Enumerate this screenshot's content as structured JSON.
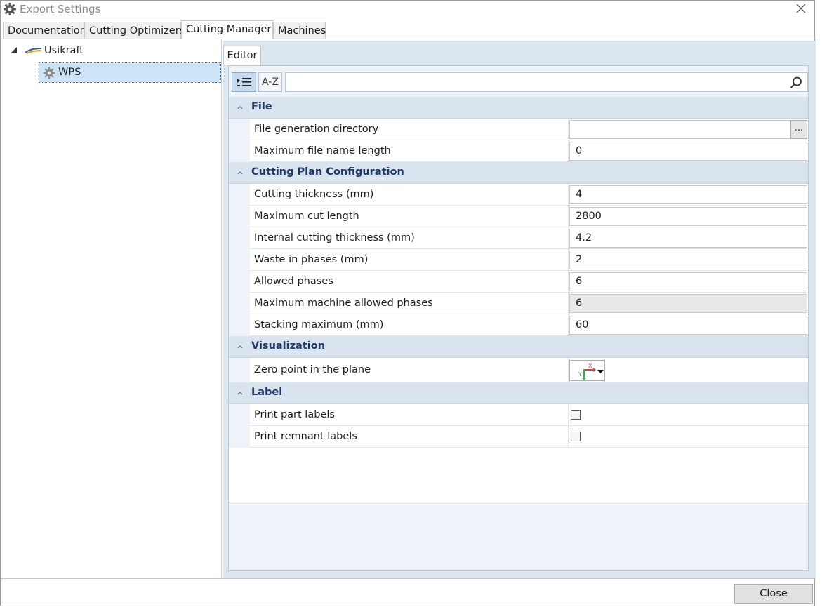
{
  "window": {
    "title": "Export Settings"
  },
  "tabs": [
    "Documentation",
    "Cutting Optimizers",
    "Cutting Manager",
    "Machines"
  ],
  "active_tab": "Cutting Manager",
  "tree": {
    "root": "Usikraft",
    "child": "WPS"
  },
  "editor": {
    "tab_label": "Editor",
    "alpha_sort_label": "A-Z",
    "search_placeholder": ""
  },
  "sections": {
    "file": {
      "label": "File",
      "file_generation_directory": {
        "name": "File generation directory",
        "value": ""
      },
      "browse_label": "...",
      "max_file_name_length": {
        "name": "Maximum file name length",
        "value": "0"
      }
    },
    "cutting_plan": {
      "label": "Cutting Plan Configuration",
      "cutting_thickness": {
        "name": "Cutting thickness (mm)",
        "value": "4"
      },
      "max_cut_length": {
        "name": "Maximum cut length",
        "value": "2800"
      },
      "internal_cutting_thickness": {
        "name": "Internal cutting thickness (mm)",
        "value": "4.2"
      },
      "waste_in_phases": {
        "name": "Waste in phases (mm)",
        "value": "2"
      },
      "allowed_phases": {
        "name": "Allowed phases",
        "value": "6"
      },
      "max_machine_allowed_phases": {
        "name": "Maximum machine allowed phases",
        "value": "6"
      },
      "stacking_maximum": {
        "name": "Stacking maximum (mm)",
        "value": "60"
      }
    },
    "visualization": {
      "label": "Visualization",
      "zero_point": {
        "name": "Zero point in the plane"
      },
      "axis_x": "X",
      "axis_y": "Y"
    },
    "label": {
      "label": "Label",
      "print_part_labels": {
        "name": "Print part labels",
        "checked": false
      },
      "print_remnant_labels": {
        "name": "Print remnant labels",
        "checked": false
      }
    }
  },
  "footer": {
    "close_label": "Close"
  },
  "colors": {
    "selection": "#cde4f7",
    "category_bg": "#dae4ef",
    "category_text": "#1f3864",
    "panel_bg": "#dce6f1"
  }
}
